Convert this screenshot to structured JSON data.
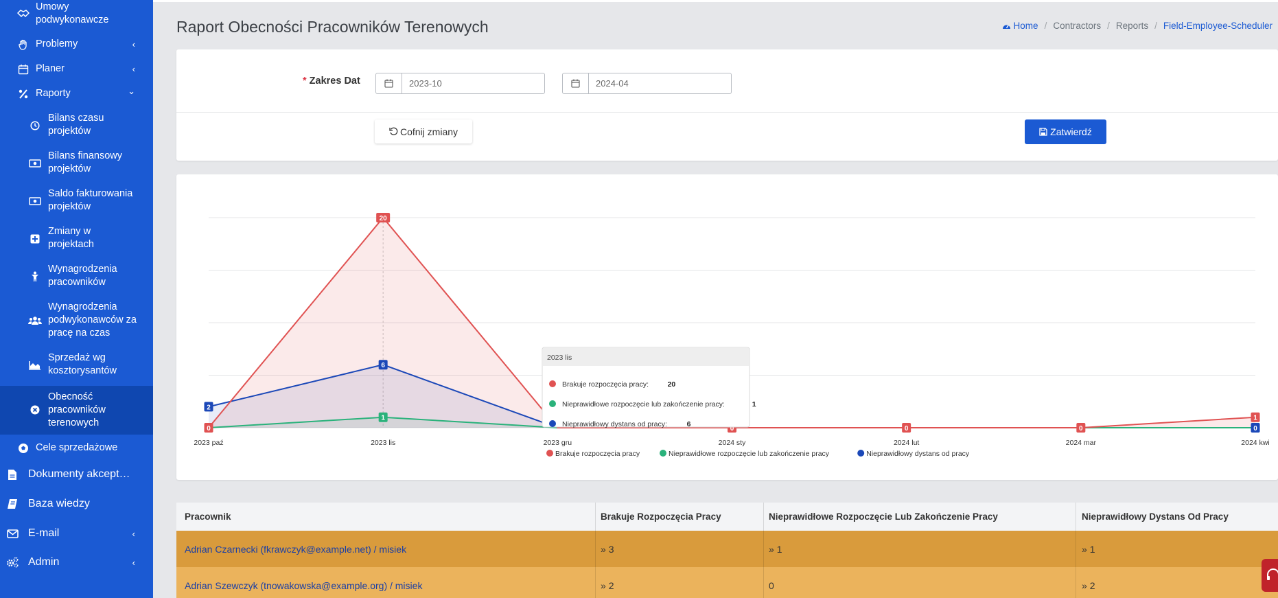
{
  "sidebar": {
    "items": [
      {
        "label_line1": "Umowy",
        "label_line2": "podwykonawcze",
        "icon": "handshake-icon"
      },
      {
        "label": "Problemy",
        "icon": "hand-icon",
        "chevron": "‹"
      },
      {
        "label": "Planer",
        "icon": "calendar-icon",
        "chevron": "‹"
      },
      {
        "label": "Raporty",
        "icon": "percent-icon",
        "chevron": "⌄"
      },
      {
        "label_line1": "Bilans czasu",
        "label_line2": "projektów",
        "icon": "clock-icon"
      },
      {
        "label_line1": "Bilans finansowy",
        "label_line2": "projektów",
        "icon": "money-icon"
      },
      {
        "label_line1": "Saldo fakturowania",
        "label_line2": "projektów",
        "icon": "money-icon"
      },
      {
        "label_line1": "Zmiany w",
        "label_line2": "projektach",
        "icon": "plus-square-icon"
      },
      {
        "label_line1": "Wynagrodzenia",
        "label_line2": "pracowników",
        "icon": "person-icon"
      },
      {
        "label_line1": "Wynagrodzenia",
        "label_line2": "podwykonawców za",
        "label_line3": "pracę na czas",
        "icon": "users-icon"
      },
      {
        "label_line1": "Sprzedaż wg",
        "label_line2": "kosztorysantów",
        "icon": "area-chart-icon"
      },
      {
        "label_line1": "Obecność",
        "label_line2": "pracowników",
        "label_line3": "terenowych",
        "icon": "times-circle-icon"
      },
      {
        "label": "Cele sprzedażowe",
        "icon": "futbol-icon"
      },
      {
        "label": "Dokumenty akcept…",
        "icon": "file-icon"
      },
      {
        "label": "Baza wiedzy",
        "icon": "book-icon"
      },
      {
        "label": "E-mail",
        "icon": "envelope-icon",
        "chevron": "‹"
      },
      {
        "label": "Admin",
        "icon": "cogs-icon",
        "chevron": "‹"
      }
    ]
  },
  "header": {
    "title": "Raport Obecności Pracowników Terenowych",
    "breadcrumb": [
      "Home",
      "Contractors",
      "Reports",
      "Field-Employee-Scheduler"
    ]
  },
  "form": {
    "date_label": "Zakres Dat",
    "required_mark": "*",
    "date_from": "2023-10",
    "date_to": "2024-04",
    "reset_label": "Cofnij zmiany",
    "submit_label": "Zatwierdź"
  },
  "chart_data": {
    "type": "line",
    "categories": [
      "2023 paź",
      "2023 lis",
      "2023 gru",
      "2024 sty",
      "2024 lut",
      "2024 mar",
      "2024 kwi"
    ],
    "series": [
      {
        "name": "Brakuje rozpoczęcia pracy",
        "color": "#e05252",
        "values": [
          0,
          20,
          0,
          0,
          0,
          0,
          1
        ]
      },
      {
        "name": "Nieprawidłowe rozpoczęcie lub zakończenie pracy",
        "color": "#2ab27b",
        "values": [
          0,
          1,
          0,
          0,
          0,
          0,
          0
        ]
      },
      {
        "name": "Nieprawidłowy dystans od pracy",
        "color": "#1b48b8",
        "values": [
          2,
          6,
          0,
          0,
          0,
          0,
          0
        ]
      }
    ],
    "ylim": [
      0,
      20
    ],
    "grid": true,
    "legend": "bottom",
    "tooltip": {
      "title": "2023 lis",
      "rows": [
        {
          "label": "Brakuje rozpoczęcia pracy:",
          "value": "20"
        },
        {
          "label": "Nieprawidłowe rozpoczęcie lub zakończenie pracy:",
          "value": "1"
        },
        {
          "label": "Nieprawidłowy dystans od pracy:",
          "value": "6"
        }
      ]
    }
  },
  "table": {
    "headers": [
      "Pracownik",
      "Brakuje Rozpoczęcia Pracy",
      "Nieprawidłowe Rozpoczęcie Lub Zakończenie Pracy",
      "Nieprawidłowy Dystans Od Pracy"
    ],
    "rows": [
      {
        "employee": "Adrian Czarnecki (fkrawczyk@example.net) / misiek",
        "missing": "3",
        "invalid": "1",
        "distance": "1",
        "color": "#d99b3c"
      },
      {
        "employee": "Adrian Szewczyk (tnowakowska@example.org) / misiek",
        "missing": "2",
        "invalid": "0",
        "distance": "2",
        "color": "#ebb35c"
      }
    ]
  },
  "colors": {
    "accent": "#1b5ad3",
    "sidebar_active": "#0f47b0"
  }
}
